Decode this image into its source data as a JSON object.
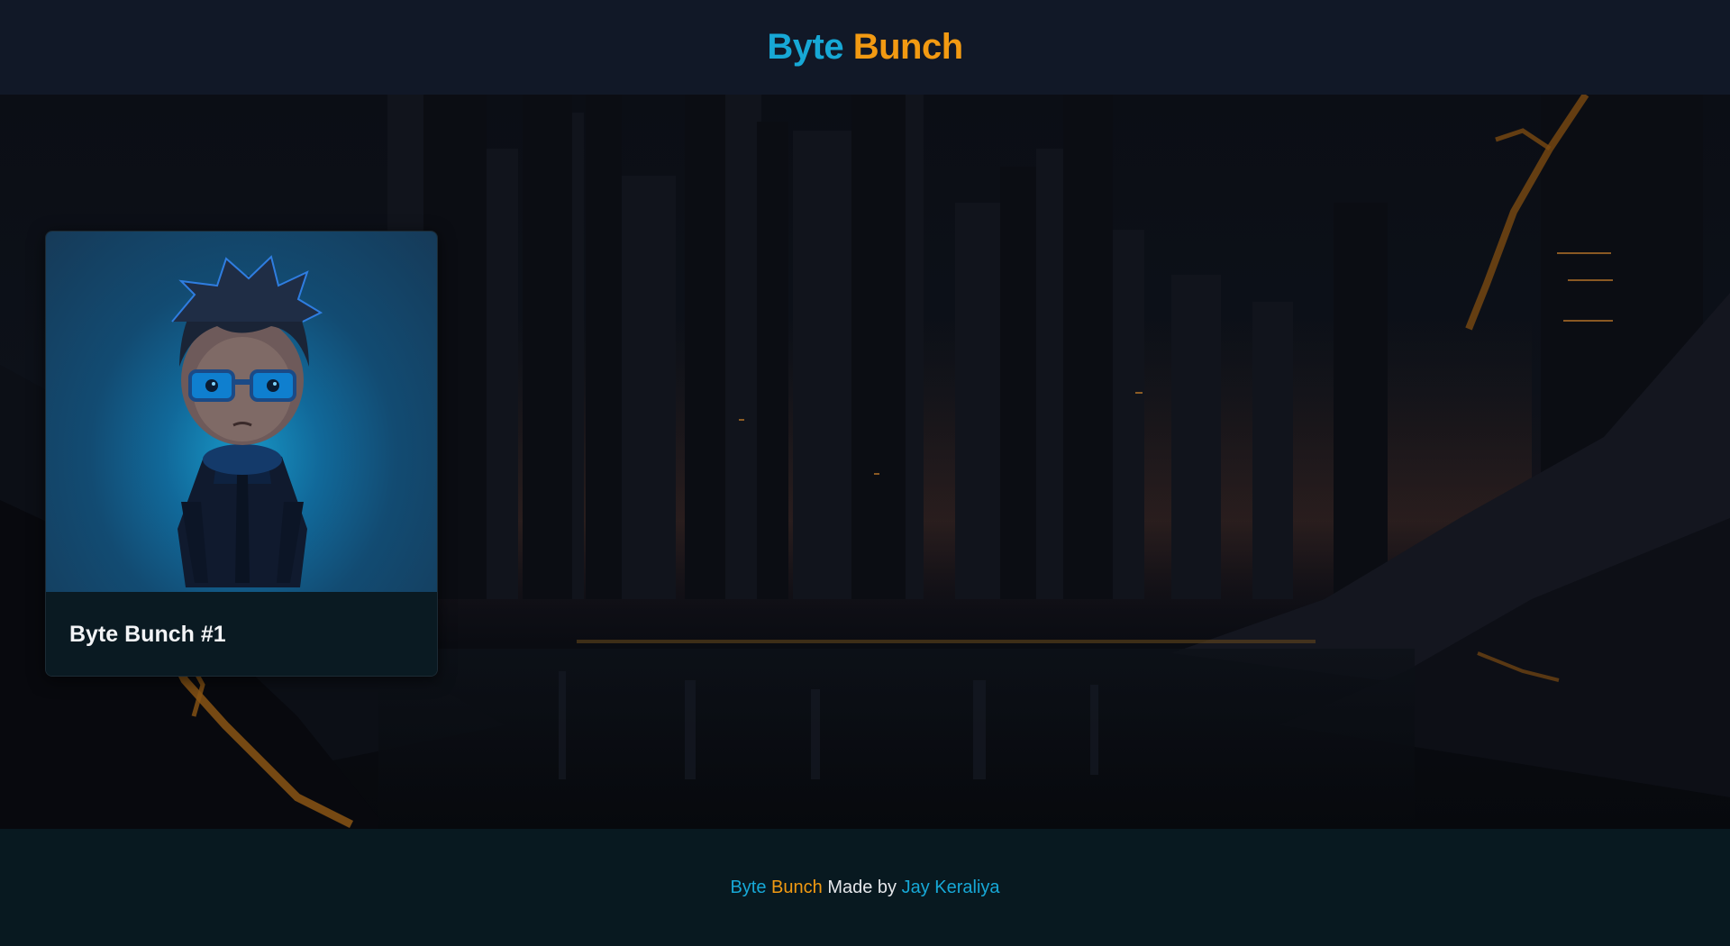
{
  "header": {
    "brand_part1": "Byte",
    "brand_part2": "Bunch"
  },
  "colors": {
    "brand_blue": "#17a8d6",
    "brand_orange": "#f29a12",
    "header_bg": "#111827",
    "footer_bg": "#081920",
    "card_footer_bg": "#0a1a22"
  },
  "background": {
    "image_description_icon": "dark-city-landscape-icon"
  },
  "cards": [
    {
      "title": "Byte Bunch #1",
      "image_icon": "nft-character-icon"
    }
  ],
  "footer": {
    "brand_part1": "Byte",
    "brand_part2": "Bunch",
    "made_by": "Made by",
    "author": "Jay Keraliya"
  }
}
